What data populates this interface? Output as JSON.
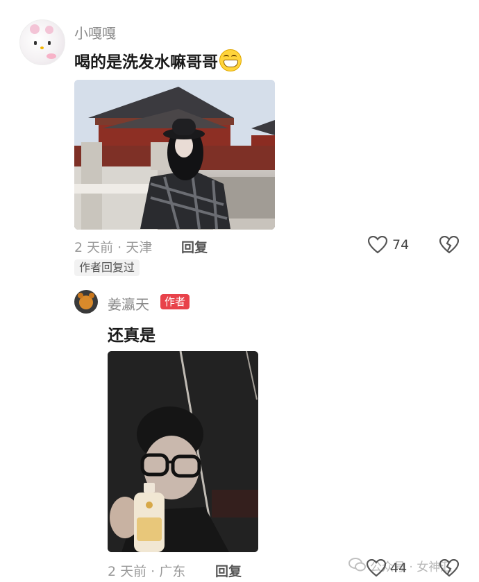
{
  "comment": {
    "username": "小嘎嘎",
    "text": "喝的是洗发水嘛哥哥",
    "emoji_icon": "grinning-face-icon",
    "meta": "2 天前 · 天津",
    "reply_label": "回复",
    "like_count": "74",
    "author_replied_tag": "作者回复过"
  },
  "reply": {
    "username": "姜瀛天",
    "author_badge": "作者",
    "text": "还真是",
    "meta": "2 天前 · 广东",
    "reply_label": "回复",
    "like_count": "44"
  },
  "watermark": "公众号 · 女神汇",
  "colors": {
    "author_badge_bg": "#e8424a",
    "meta_text": "#999999",
    "username_text": "#8a8a8a"
  }
}
